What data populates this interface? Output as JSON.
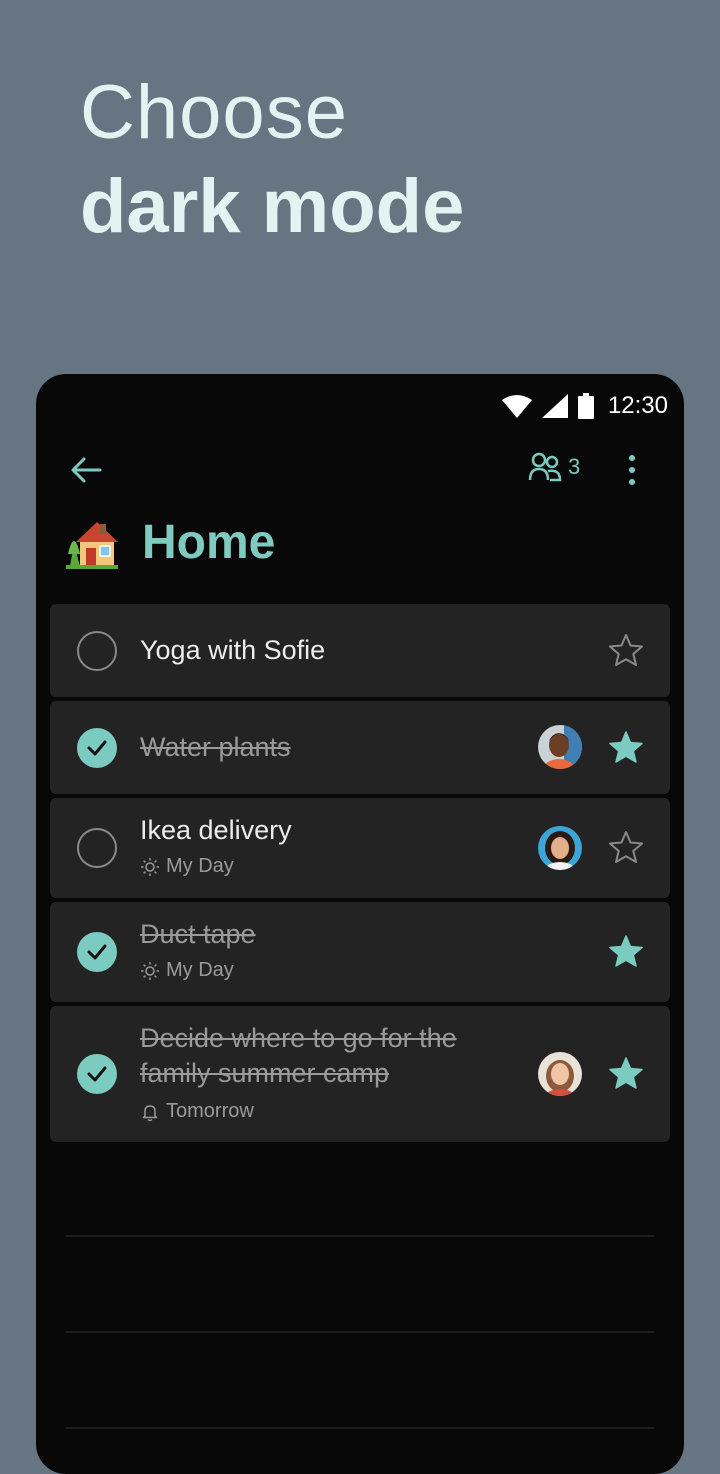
{
  "hero": {
    "line1": "Choose",
    "line2": "dark mode"
  },
  "status_bar": {
    "time": "12:30"
  },
  "header": {
    "members_count": "3"
  },
  "list": {
    "title": "Home",
    "emoji": "house-with-garden-icon"
  },
  "tasks": [
    {
      "title": "Yoga with Sofie",
      "completed": false,
      "starred": false
    },
    {
      "title": "Water plants",
      "completed": true,
      "starred": true,
      "assignee": "avatar"
    },
    {
      "title": "Ikea delivery",
      "completed": false,
      "starred": false,
      "meta": "My Day",
      "meta_icon": "sun-icon",
      "assignee": "avatar"
    },
    {
      "title": "Duct tape",
      "completed": true,
      "starred": true,
      "meta": "My Day",
      "meta_icon": "sun-icon"
    },
    {
      "title_line1": "Decide where to go for the",
      "title_line2": "family summer camp",
      "completed": true,
      "starred": true,
      "meta": "Tomorrow",
      "meta_icon": "bell-icon",
      "assignee": "avatar"
    }
  ],
  "colors": {
    "accent": "#7ccbc0",
    "background": "#677582",
    "card": "#232323"
  }
}
